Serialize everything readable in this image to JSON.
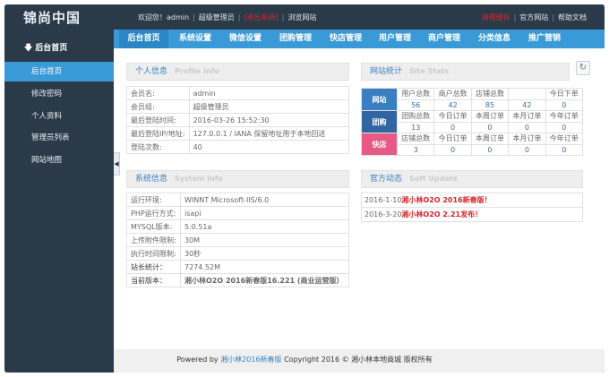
{
  "header": {
    "logo": "锦尚中国",
    "welcome": "欢迎您！admin",
    "role": "超级管理员",
    "logout": "[退出系统]",
    "browse_site": "浏览网站",
    "clear_cache": "清理缓存",
    "official_site": "官方网站",
    "help_docs": "帮助文档"
  },
  "nav": {
    "tabs": [
      "后台首页",
      "系统设置",
      "微信设置",
      "团购管理",
      "快店管理",
      "用户管理",
      "商户管理",
      "分类信息",
      "推广营销"
    ]
  },
  "sidebar": {
    "heading": "后台首页",
    "items": [
      "后台首页",
      "修改密码",
      "个人资料",
      "管理员列表",
      "网站地图"
    ]
  },
  "personal": {
    "title": "个人信息",
    "title_en": "Profile Info",
    "rows": [
      {
        "k": "会员名:",
        "v": "admin"
      },
      {
        "k": "会员组:",
        "v": "超级管理员"
      },
      {
        "k": "最后登陆时间:",
        "v": "2016-03-26 15:52:30"
      },
      {
        "k": "最后登陆IP/地址:",
        "v": "127.0.0.1 / IANA 保留地址用于本地回送"
      },
      {
        "k": "登陆次数:",
        "v": "40"
      }
    ]
  },
  "sysinfo": {
    "title": "系统信息",
    "title_en": "System Info",
    "rows": [
      {
        "k": "运行环境:",
        "v": "WINNT Microsoft-IIS/6.0"
      },
      {
        "k": "PHP运行方式:",
        "v": "isapi"
      },
      {
        "k": "MYSQL版本:",
        "v": "5.0.51a"
      },
      {
        "k": "上传附件限制:",
        "v": "30M"
      },
      {
        "k": "执行时间限制:",
        "v": "30秒"
      },
      {
        "k": "站长统计：",
        "v": "7274.52M"
      },
      {
        "k": "当前版本：",
        "v": "湘小林O2O 2016新春版16.221 (商业运营版）"
      }
    ]
  },
  "stats": {
    "title": "网站统计",
    "title_en": "Site Stats",
    "refresh_icon": "↻",
    "groups": [
      {
        "cat": "网站",
        "color": "#3a7fc2",
        "headers": [
          "用户总数",
          "商户总数",
          "店铺总数",
          "",
          "今日下单"
        ],
        "values": [
          "56",
          "42",
          "85",
          "42",
          "0"
        ]
      },
      {
        "cat": "团购",
        "color": "#3166a3",
        "headers": [
          "团购总数",
          "今日订单",
          "本周订单",
          "本月订单",
          "今年订单"
        ],
        "values": [
          "13",
          "0",
          "0",
          "0",
          "0"
        ]
      },
      {
        "cat": "快店",
        "color": "#e85a86",
        "headers": [
          "店铺总数",
          "今日订单",
          "本周订单",
          "本月订单",
          "今年订单"
        ],
        "values": [
          "3",
          "0",
          "0",
          "0",
          "0"
        ]
      }
    ]
  },
  "news": {
    "title": "官方动态",
    "title_en": "Soft Update",
    "items": [
      {
        "date": "2016-1-10",
        "text": "湘小林O2O 2016新春版！"
      },
      {
        "date": "2016-3-20",
        "text": "湘小林O2O 2.21发布！"
      }
    ]
  },
  "footer": {
    "prefix": "Powered by",
    "link": "湘小林2016新春版",
    "suffix": "Copyright 2016 © 湘小林本地商城 版权所有"
  },
  "colors": {
    "dark": "#2b3a48",
    "accent": "#3a9ad8",
    "red": "#d9242b"
  }
}
